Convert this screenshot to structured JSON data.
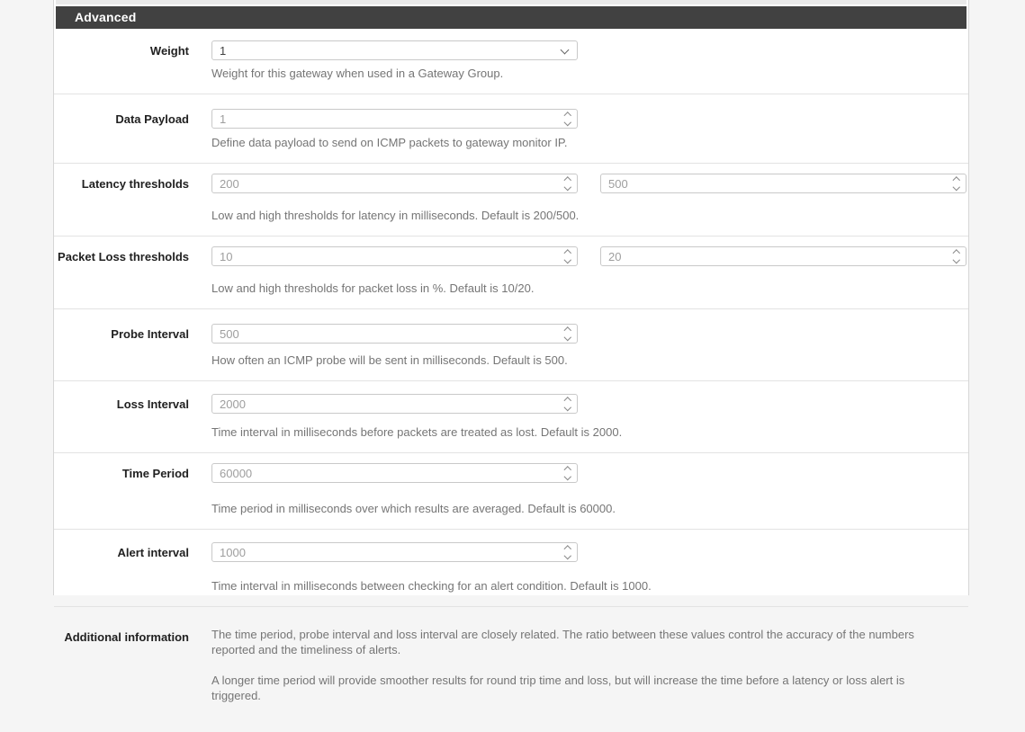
{
  "panel": {
    "title": "Advanced"
  },
  "rows": [
    {
      "label": "Weight",
      "type": "select",
      "value": "1",
      "help": "Weight for this gateway when used in a Gateway Group."
    },
    {
      "label": "Data Payload",
      "type": "number",
      "value": "1",
      "help": "Define data payload to send on ICMP packets to gateway monitor IP."
    },
    {
      "label": "Latency thresholds",
      "type": "number-pair",
      "value_low": "200",
      "value_high": "500",
      "help": "Low and high thresholds for latency in milliseconds. Default is 200/500."
    },
    {
      "label": "Packet Loss thresholds",
      "type": "number-pair",
      "value_low": "10",
      "value_high": "20",
      "help": "Low and high thresholds for packet loss in %. Default is 10/20."
    },
    {
      "label": "Probe Interval",
      "type": "number",
      "value": "500",
      "help": "How often an ICMP probe will be sent in milliseconds. Default is 500."
    },
    {
      "label": "Loss Interval",
      "type": "number",
      "value": "2000",
      "help": "Time interval in milliseconds before packets are treated as lost. Default is 2000."
    },
    {
      "label": "Time Period",
      "type": "number",
      "value": "60000",
      "help": "Time period in milliseconds over which results are averaged. Default is 60000."
    },
    {
      "label": "Alert interval",
      "type": "number",
      "value": "1000",
      "help": "Time interval in milliseconds between checking for an alert condition. Default is 1000."
    }
  ],
  "additional": {
    "label": "Additional information",
    "paragraph1": "The time period, probe interval and loss interval are closely related. The ratio between these values control the accuracy of the numbers reported and the timeliness of alerts.",
    "paragraph2": "A longer time period will provide smoother results for round trip time and loss, but will increase the time before a latency or loss alert is triggered."
  },
  "colors": {
    "header_bg": "#414141",
    "header_text": "#ffffff",
    "label_text": "#212121",
    "help_text": "#757575",
    "input_border": "#c9c9c9",
    "placeholder_text": "#9e9e9e",
    "row_divider": "#e3e3e3",
    "page_bg": "#f5f5f5",
    "top_strip": "#e9e9e9"
  }
}
